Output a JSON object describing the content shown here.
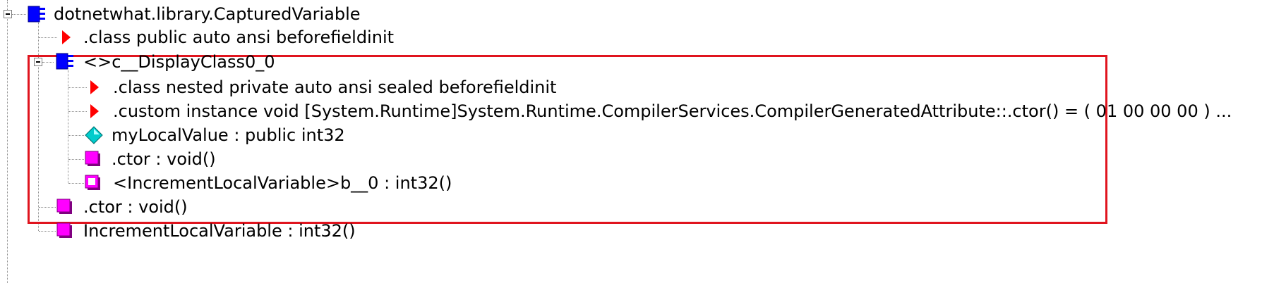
{
  "tree": {
    "root": {
      "label": "dotnetwhat.library.CapturedVariable",
      "icon": "class-icon",
      "expanded": true,
      "children": {
        "class_directive": {
          "label": ".class public auto ansi beforefieldinit",
          "icon": "red-triangle-icon"
        },
        "display_class": {
          "label": "<>c__DisplayClass0_0",
          "icon": "class-icon",
          "expanded": true,
          "children": {
            "class_directive": {
              "label": ".class nested private auto ansi sealed beforefieldinit",
              "icon": "red-triangle-icon"
            },
            "custom_attribute": {
              "label": ".custom instance void [System.Runtime]System.Runtime.CompilerServices.CompilerGeneratedAttribute::.ctor() = ( 01 00 00 00 )  ...",
              "icon": "red-triangle-icon"
            },
            "field": {
              "label": "myLocalValue : public int32",
              "icon": "cyan-diamond-icon"
            },
            "ctor": {
              "label": ".ctor : void()",
              "icon": "magenta-method-icon"
            },
            "lambda_method": {
              "label": "<IncrementLocalVariable>b__0 : int32()",
              "icon": "hollow-method-icon"
            }
          }
        },
        "ctor": {
          "label": ".ctor : void()",
          "icon": "magenta-method-icon"
        },
        "increment_method": {
          "label": "IncrementLocalVariable : int32()",
          "icon": "magenta-method-icon"
        }
      }
    },
    "highlight_color": "#e0141e",
    "class_icon_color": "#0000ff",
    "method_icon_color": "#ff00ff",
    "field_icon_color": "#00cccc",
    "directive_icon_color": "#ff0000"
  }
}
